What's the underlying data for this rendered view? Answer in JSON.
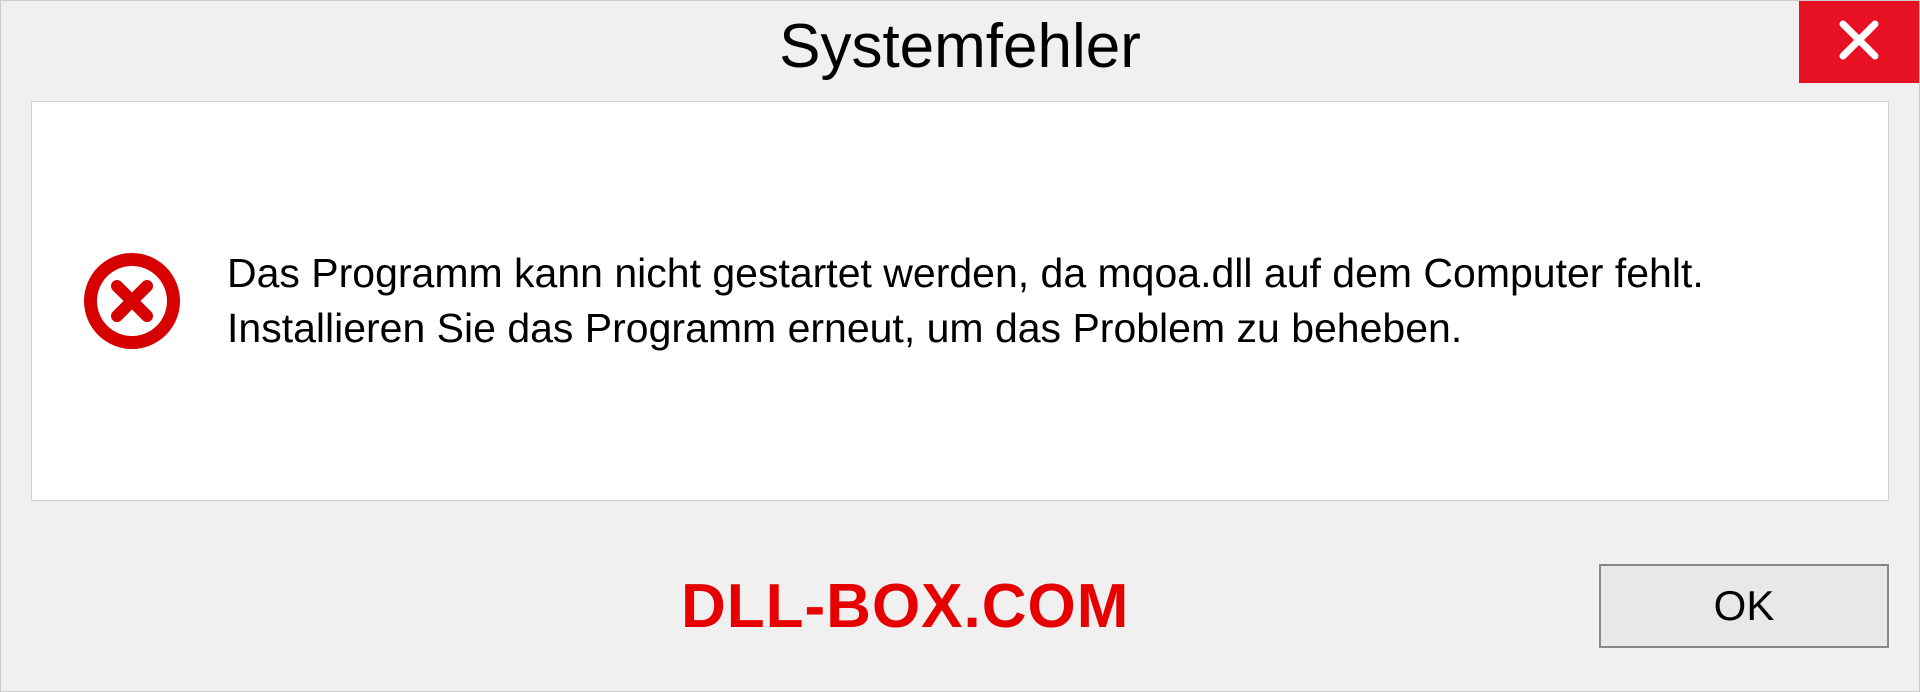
{
  "dialog": {
    "title": "Systemfehler",
    "message": "Das Programm kann nicht gestartet werden, da mqoa.dll auf dem Computer fehlt. Installieren Sie das Programm erneut, um das Problem zu beheben.",
    "ok_label": "OK"
  },
  "watermark": "DLL-BOX.COM",
  "colors": {
    "close_button": "#e81123",
    "error_icon": "#d60000",
    "watermark": "#e60000"
  }
}
